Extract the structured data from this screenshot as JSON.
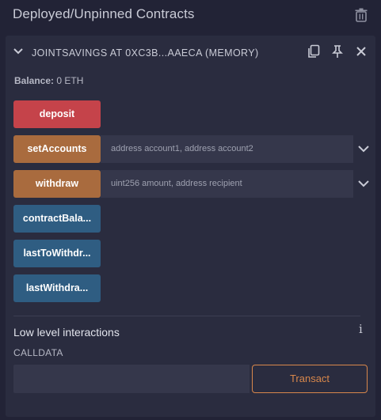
{
  "header": {
    "title": "Deployed/Unpinned Contracts",
    "trash_icon": "trash-icon"
  },
  "instance": {
    "title": "JOINTSAVINGS AT 0XC3B...AAECA (MEMORY)",
    "icons": [
      "chevron-down-icon",
      "copy-icon",
      "pin-icon",
      "close-icon"
    ]
  },
  "balance": {
    "label": "Balance:",
    "value": "0 ETH"
  },
  "functions": [
    {
      "label": "deposit",
      "color": "#c5434a"
    },
    {
      "label": "setAccounts",
      "color": "#a96b3e",
      "placeholder": "address account1, address account2"
    },
    {
      "label": "withdraw",
      "color": "#a96b3e",
      "placeholder": "uint256 amount, address recipient"
    },
    {
      "label": "contractBala...",
      "color": "#2f5d82"
    },
    {
      "label": "lastToWithdr...",
      "color": "#2f5d82"
    },
    {
      "label": "lastWithdra...",
      "color": "#2f5d82"
    }
  ],
  "low_level": {
    "title": "Low level interactions",
    "info_glyph": "i",
    "calldata_label": "CALLDATA",
    "transact_label": "Transact"
  }
}
